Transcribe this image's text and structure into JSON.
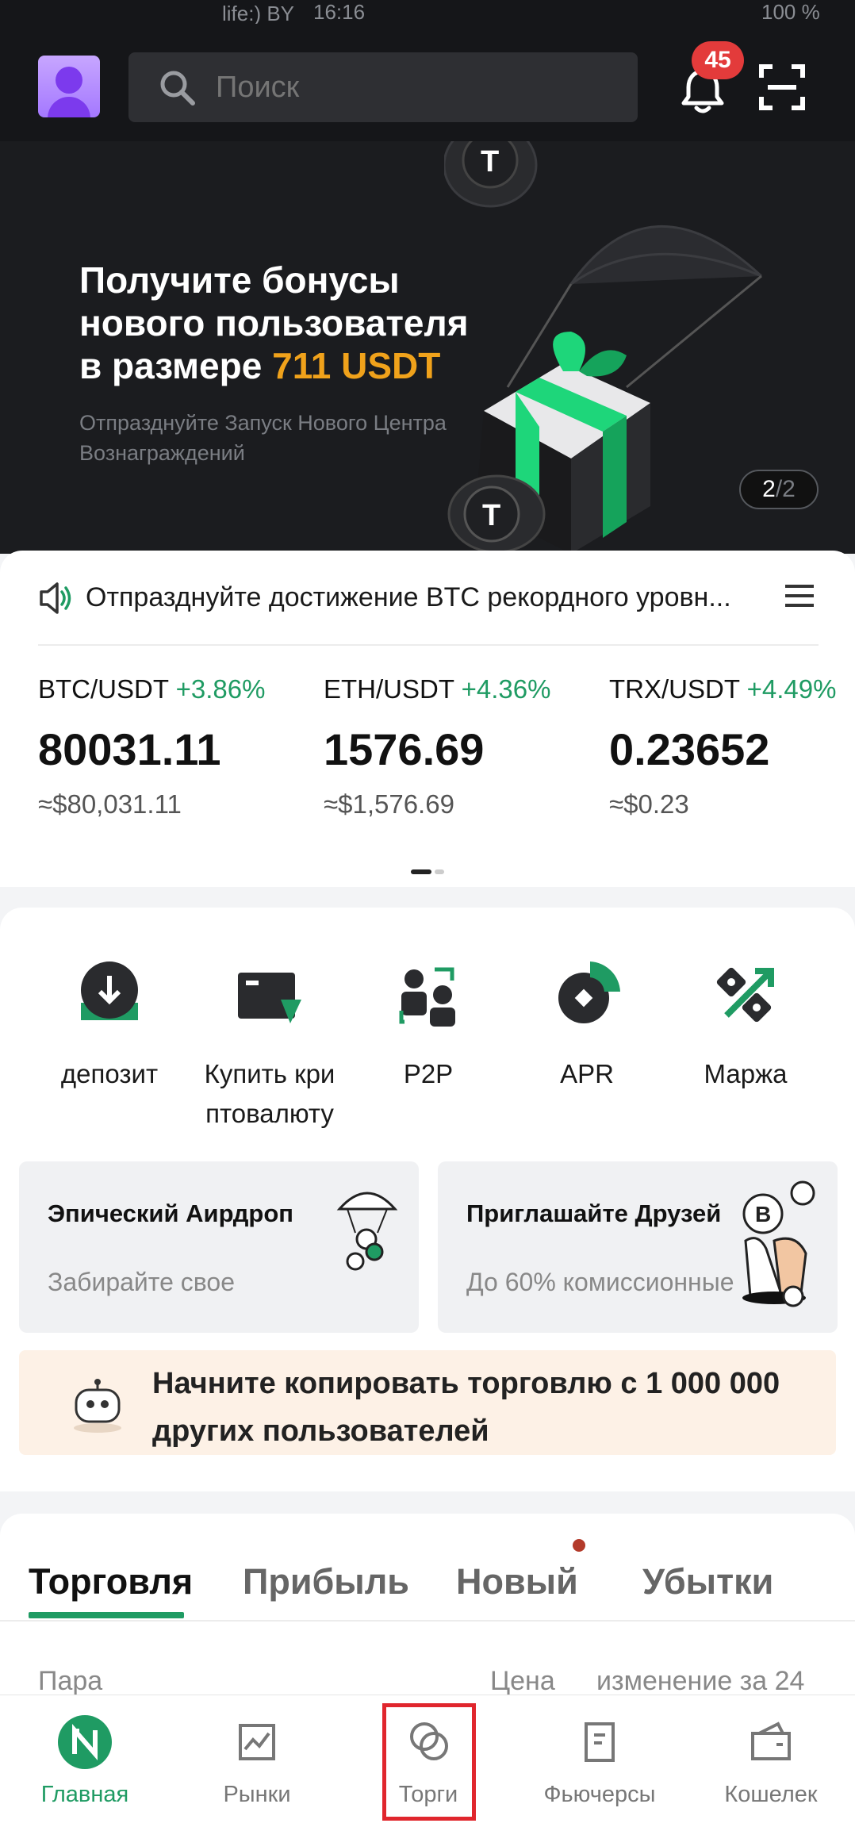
{
  "status_bar": {
    "carrier": "life:) BY",
    "clock": "16:16",
    "battery": "100 %"
  },
  "header": {
    "search_placeholder": "Поиск",
    "notification_count": "45"
  },
  "banner": {
    "title_line1": "Получите бонусы",
    "title_line2": "нового пользователя",
    "title_line3_prefix": "в размере ",
    "title_highlight": "711 USDT",
    "subtitle": "Отпразднуйте Запуск Нового Центра Вознаграждений",
    "page_current": "2",
    "page_separator": "/",
    "page_total": "2",
    "accent_color": "#f0a21b"
  },
  "announcement": {
    "text": "Отпразднуйте достижение BTC рекордного уровн..."
  },
  "tickers": [
    {
      "pair": "BTC/USDT",
      "change": "+3.86%",
      "price": "80031.11",
      "usd": "≈$80,031.11"
    },
    {
      "pair": "ETH/USDT",
      "change": "+4.36%",
      "price": "1576.69",
      "usd": "≈$1,576.69"
    },
    {
      "pair": "TRX/USDT",
      "change": "+4.49%",
      "price": "0.23652",
      "usd": "≈$0.23"
    }
  ],
  "actions": [
    {
      "label": "депозит",
      "icon": "deposit-icon"
    },
    {
      "label": "Купить криптовалюту",
      "label_line1": "Купить кри",
      "label_line2": "птовалюту",
      "icon": "buy-crypto-icon"
    },
    {
      "label": "P2P",
      "icon": "p2p-icon"
    },
    {
      "label": "APR",
      "icon": "apr-icon"
    },
    {
      "label": "Маржа",
      "icon": "margin-icon"
    }
  ],
  "promo_cards": [
    {
      "title": "Эпический Аирдроп",
      "subtitle": "Забирайте свое",
      "icon": "airdrop-icon"
    },
    {
      "title": "Приглашайте Друзей",
      "subtitle": "До 60% комиссионные",
      "icon": "invite-friends-icon"
    }
  ],
  "copy_trading": {
    "text": "Начните копировать торговлю с 1 000 000 других пользователей",
    "icon": "robot-icon"
  },
  "market_tabs": [
    "Торговля",
    "Прибыль",
    "Новый",
    "Убытки"
  ],
  "market_columns": {
    "pair": "Пара",
    "price": "Цена",
    "change": "изменение за 24"
  },
  "bottom_nav": [
    {
      "label": "Главная",
      "icon": "home-logo-icon",
      "active": true
    },
    {
      "label": "Рынки",
      "icon": "markets-chart-icon",
      "active": false
    },
    {
      "label": "Торги",
      "icon": "trade-circles-icon",
      "active": false
    },
    {
      "label": "Фьючерсы",
      "icon": "futures-doc-icon",
      "active": false
    },
    {
      "label": "Кошелек",
      "icon": "wallet-icon",
      "active": false
    }
  ],
  "colors": {
    "green": "#1f9b63",
    "red_highlight": "#e0262d",
    "badge": "#e33b3b",
    "header_bg": "#151619"
  }
}
